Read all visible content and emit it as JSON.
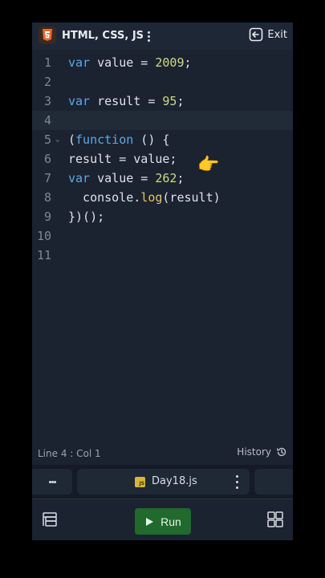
{
  "header": {
    "title": "HTML, CSS, JS",
    "exit_label": "Exit"
  },
  "editor": {
    "lines": [
      {
        "n": "1"
      },
      {
        "n": "2"
      },
      {
        "n": "3"
      },
      {
        "n": "4"
      },
      {
        "n": "5"
      },
      {
        "n": "6"
      },
      {
        "n": "7"
      },
      {
        "n": "8"
      },
      {
        "n": "9"
      },
      {
        "n": "10"
      },
      {
        "n": "11"
      }
    ],
    "active_line": 4,
    "code": {
      "l1_kw": "var",
      "l1_rest": " value = ",
      "l1_num": "2009",
      "l1_end": ";",
      "l3_kw": "var",
      "l3_rest": " result = ",
      "l3_num": "95",
      "l3_end": ";",
      "l5_open": "(",
      "l5_kw": "function",
      "l5_rest": " () {",
      "l6": "result = value;",
      "l7_kw": "var",
      "l7_rest": " value = ",
      "l7_num": "262",
      "l7_end": ";",
      "l8_pre": "  console.",
      "l8_fn": "log",
      "l8_post": "(result)",
      "l9": "})();"
    },
    "pointer_emoji": "👉"
  },
  "status": {
    "position": "Line 4 : Col 1",
    "history_label": "History"
  },
  "tabs": {
    "file_name": "Day18.js",
    "file_icon_text": "JS"
  },
  "toolbar": {
    "run_label": "Run"
  },
  "colors": {
    "background": "#1b2330",
    "keyword": "#5aa8e8",
    "number": "#cfd98a",
    "run_button": "#1f6a2c"
  },
  "icons": [
    "html5-icon",
    "more-vertical-icon",
    "exit-icon",
    "history-icon",
    "js-file-icon",
    "panel-icon",
    "play-icon",
    "grid-icon"
  ]
}
